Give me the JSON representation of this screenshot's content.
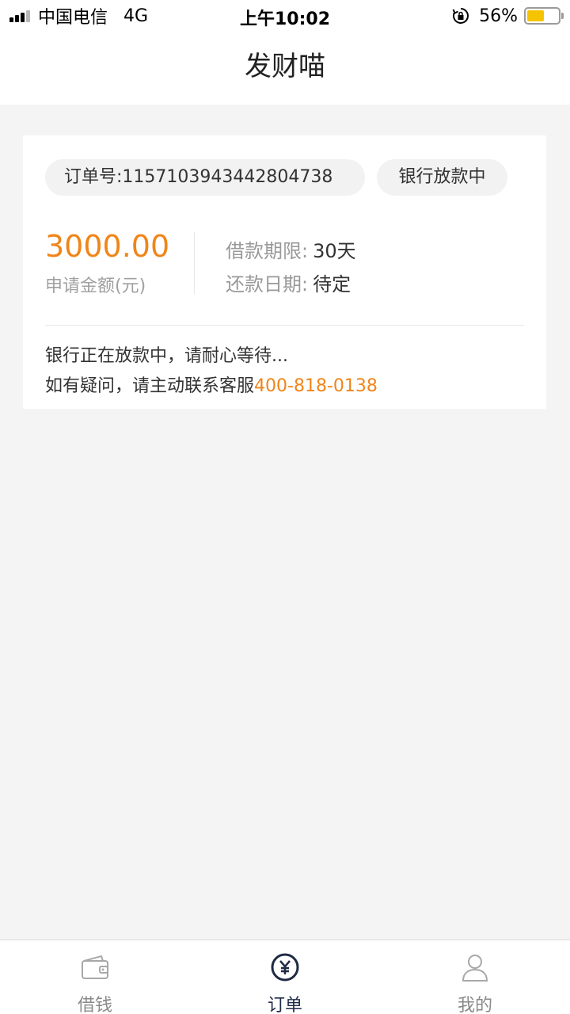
{
  "status_bar": {
    "carrier": "中国电信",
    "network": "4G",
    "time": "上午10:02",
    "battery": "56%",
    "battery_level": 0.56
  },
  "nav": {
    "title": "发财喵"
  },
  "order": {
    "order_label": "订单号:",
    "order_number": "1157103943442804738",
    "status": "银行放款中",
    "amount": "3000.00",
    "amount_label": "申请金额(元)",
    "term_label": "借款期限:",
    "term_value": "30天",
    "repay_label": "还款日期:",
    "repay_value": "待定",
    "message_line1": "银行正在放款中，请耐心等待...",
    "message_line2_prefix": "如有疑问，请主动联系客服",
    "phone": "400-818-0138"
  },
  "tabs": [
    {
      "label": "借钱",
      "icon": "wallet-icon",
      "active": false
    },
    {
      "label": "订单",
      "icon": "yen-circle-icon",
      "active": true
    },
    {
      "label": "我的",
      "icon": "user-icon",
      "active": false
    }
  ],
  "colors": {
    "accent": "#f08519",
    "active_tab": "#1f2a44",
    "background": "#f4f4f4"
  }
}
